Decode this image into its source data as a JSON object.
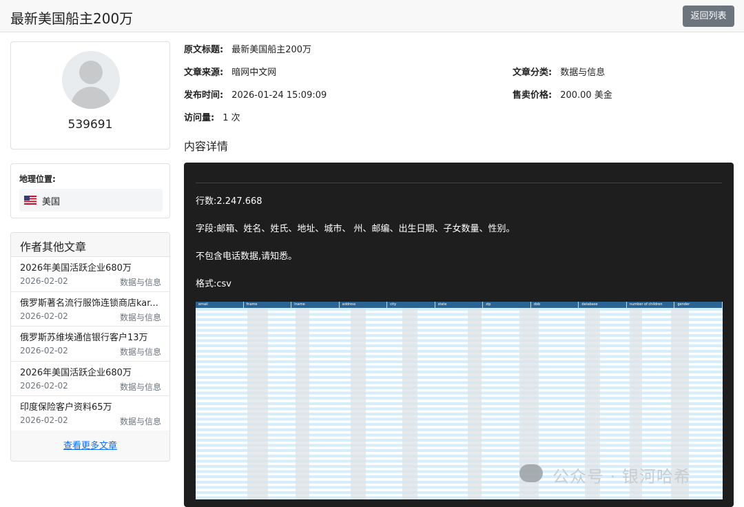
{
  "header": {
    "title": "最新美国船主200万",
    "back_label": "返回列表"
  },
  "profile": {
    "user_id": "539691"
  },
  "location": {
    "label": "地理位置:",
    "country": "美国"
  },
  "other_articles": {
    "heading": "作者其他文章",
    "items": [
      {
        "title": "2026年美国活跃企业680万",
        "date": "2026-02-02",
        "category": "数据与信息"
      },
      {
        "title": "俄罗斯著名流行服饰连锁商店kar...",
        "date": "2026-02-02",
        "category": "数据与信息"
      },
      {
        "title": "俄罗斯苏维埃通信银行客户13万",
        "date": "2026-02-02",
        "category": "数据与信息"
      },
      {
        "title": "2026年美国活跃企业680万",
        "date": "2026-02-02",
        "category": "数据与信息"
      },
      {
        "title": "印度保险客户资料65万",
        "date": "2026-02-02",
        "category": "数据与信息"
      }
    ],
    "more_link": "查看更多文章"
  },
  "info": {
    "orig_title_label": "原文标题:",
    "orig_title": "最新美国船主200万",
    "source_label": "文章来源:",
    "source": "暗网中文网",
    "category_label": "文章分类:",
    "category": "数据与信息",
    "published_label": "发布时间:",
    "published": "2026-01-24 15:09:09",
    "price_label": "售卖价格:",
    "price": "200.00 美金",
    "visits_label": "访问量:",
    "visits": "1 次"
  },
  "content": {
    "heading": "内容详情",
    "rows_line": "行数:2.247.668",
    "fields_line": "字段:邮箱、姓名、姓氏、地址、城市、 州、邮编、出生日期、子女数量、性别。",
    "note_line": "不包含电话数据,请知悉。",
    "format_line": "格式:csv",
    "sheet_columns": [
      "email",
      "fname",
      "lname",
      "address",
      "city",
      "state",
      "zip",
      "dob",
      "database",
      "number of children",
      "gender"
    ]
  },
  "watermark": {
    "text": "公众号 · 银河哈希"
  }
}
